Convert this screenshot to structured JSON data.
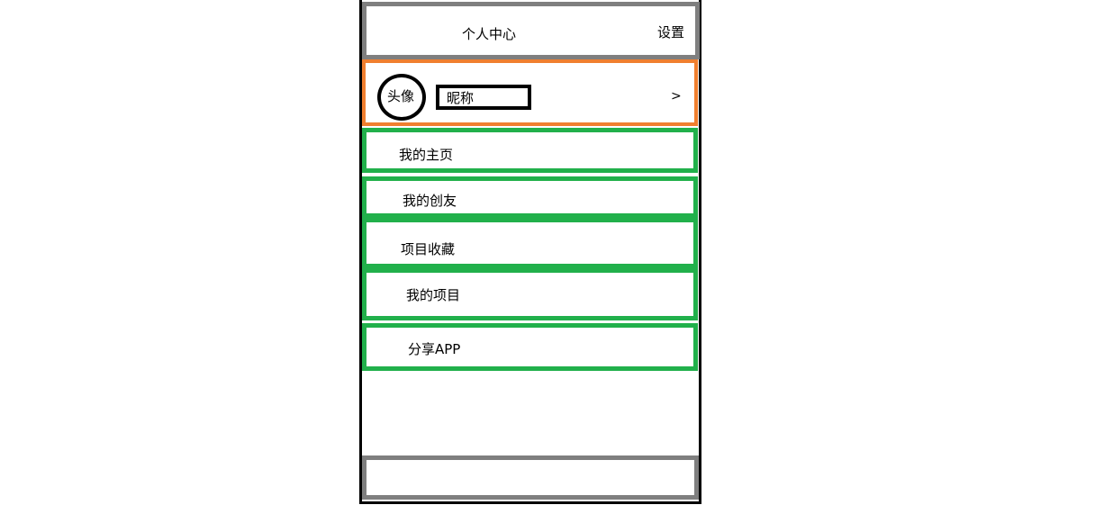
{
  "header": {
    "title": "个人中心",
    "settings_label": "设置"
  },
  "profile": {
    "avatar_label": "头像",
    "nickname_label": "昵称",
    "chevron": ">"
  },
  "menu": {
    "items": [
      {
        "label": "我的主页"
      },
      {
        "label": "我的创友"
      },
      {
        "label": "项目收藏"
      },
      {
        "label": "我的项目"
      },
      {
        "label": "分享APP"
      }
    ]
  },
  "colors": {
    "frame": "#000000",
    "bar_border": "#7f7f7f",
    "profile_border": "#f07f2f",
    "menu_border": "#21b04b"
  }
}
